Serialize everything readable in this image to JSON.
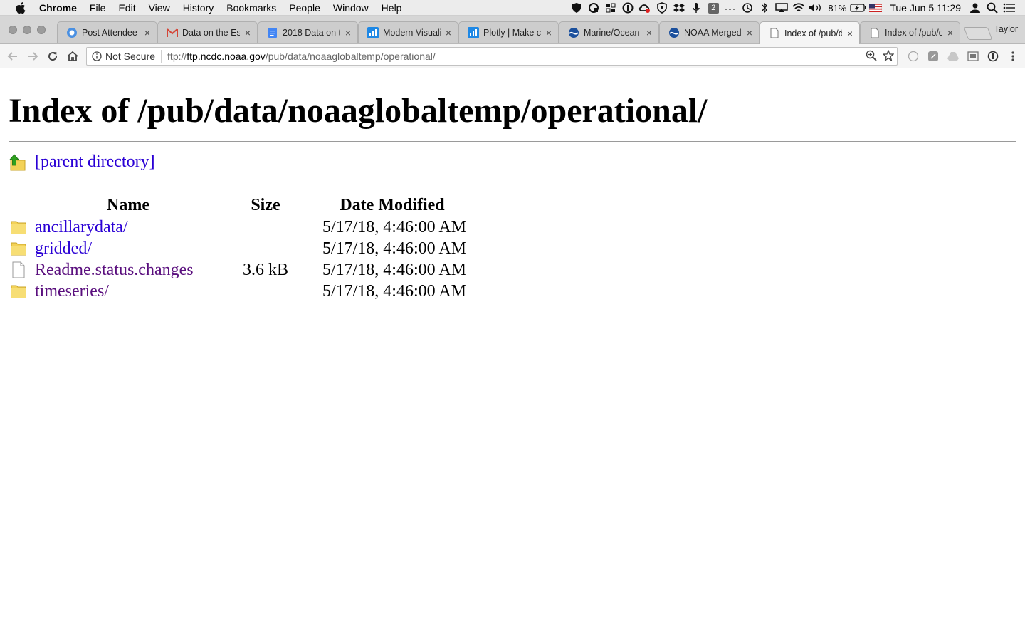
{
  "menubar": {
    "app_name": "Chrome",
    "items": [
      "File",
      "Edit",
      "View",
      "History",
      "Bookmarks",
      "People",
      "Window",
      "Help"
    ],
    "status": {
      "badge_count": "2",
      "battery": "81%",
      "clock": "Tue Jun 5  11:29"
    }
  },
  "tabs": [
    {
      "label": "Post Attendee",
      "icon": "chat-bubble-icon",
      "color": "#4a90e2"
    },
    {
      "label": "Data on the Est",
      "icon": "gmail-icon",
      "color": "#d44638"
    },
    {
      "label": "2018 Data on t",
      "icon": "docs-icon",
      "color": "#4285f4"
    },
    {
      "label": "Modern Visuali",
      "icon": "chart-icon",
      "color": "#1e88e5"
    },
    {
      "label": "Plotly | Make c",
      "icon": "chart-icon",
      "color": "#1e88e5"
    },
    {
      "label": "Marine/Ocean D",
      "icon": "noaa-icon",
      "color": "#1a4f9c"
    },
    {
      "label": "NOAA Merged L",
      "icon": "noaa-icon",
      "color": "#1a4f9c"
    },
    {
      "label": "Index of /pub/d",
      "icon": "page-icon",
      "color": "#777777",
      "active": true
    },
    {
      "label": "Index of /pub/d",
      "icon": "page-icon",
      "color": "#777777"
    }
  ],
  "profile_name": "Taylor",
  "omnibox": {
    "security_label": "Not Secure",
    "url_scheme": "ftp://",
    "url_host": "ftp.ncdc.noaa.gov",
    "url_path": "/pub/data/noaaglobaltemp/operational/"
  },
  "page": {
    "heading": "Index of /pub/data/noaaglobaltemp/operational/",
    "parent_link": "[parent directory]",
    "columns": {
      "name": "Name",
      "size": "Size",
      "date": "Date Modified"
    },
    "entries": [
      {
        "name": "ancillarydata/",
        "size": "",
        "date": "5/17/18, 4:46:00 AM",
        "type": "folder"
      },
      {
        "name": "gridded/",
        "size": "",
        "date": "5/17/18, 4:46:00 AM",
        "type": "folder"
      },
      {
        "name": "Readme.status.changes",
        "size": "3.6 kB",
        "date": "5/17/18, 4:46:00 AM",
        "type": "file"
      },
      {
        "name": "timeseries/",
        "size": "",
        "date": "5/17/18, 4:46:00 AM",
        "type": "folder"
      }
    ]
  }
}
